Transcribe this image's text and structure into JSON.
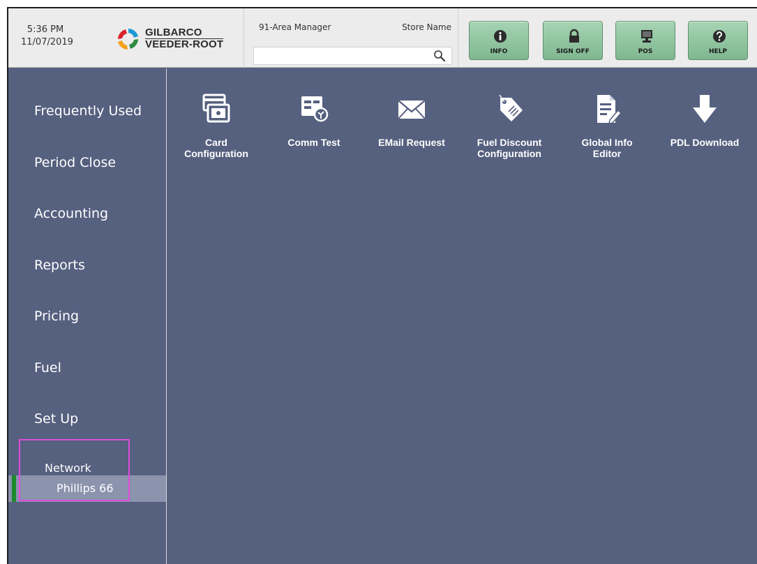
{
  "header": {
    "time": "5:36 PM",
    "date": "11/07/2019",
    "logo_line1": "GILBARCO",
    "logo_line2": "VEEDER-ROOT",
    "role": "91-Area Manager",
    "store_name": "Store Name",
    "search": {
      "value": "",
      "placeholder": ""
    },
    "buttons": [
      {
        "label": "INFO",
        "icon": "info-icon"
      },
      {
        "label": "SIGN OFF",
        "icon": "lock-icon"
      },
      {
        "label": "POS",
        "icon": "monitor-icon"
      },
      {
        "label": "HELP",
        "icon": "help-icon"
      }
    ]
  },
  "sidebar": {
    "items": [
      {
        "label": "Frequently Used"
      },
      {
        "label": "Period Close"
      },
      {
        "label": "Accounting"
      },
      {
        "label": "Reports"
      },
      {
        "label": "Pricing"
      },
      {
        "label": "Fuel"
      },
      {
        "label": "Set Up"
      }
    ],
    "submenu": {
      "label": "Network",
      "children": [
        {
          "label": "Phillips 66",
          "selected": true
        }
      ]
    }
  },
  "main": {
    "tiles": [
      {
        "label": "Card\nConfiguration",
        "icon": "card-config-icon"
      },
      {
        "label": "Comm Test",
        "icon": "comm-test-icon"
      },
      {
        "label": "EMail Request",
        "icon": "email-icon"
      },
      {
        "label": "Fuel Discount\nConfiguration",
        "icon": "tag-icon"
      },
      {
        "label": "Global Info\nEditor",
        "icon": "document-edit-icon"
      },
      {
        "label": "PDL Download",
        "icon": "download-arrow-icon"
      }
    ]
  },
  "colors": {
    "panel_bg": "#56607f",
    "header_bg": "#ececec",
    "button_green": "#8fc59f",
    "selected_row": "#8b93ad",
    "accent_green": "#1c8a2a",
    "highlight_magenta": "#e14bdd"
  }
}
